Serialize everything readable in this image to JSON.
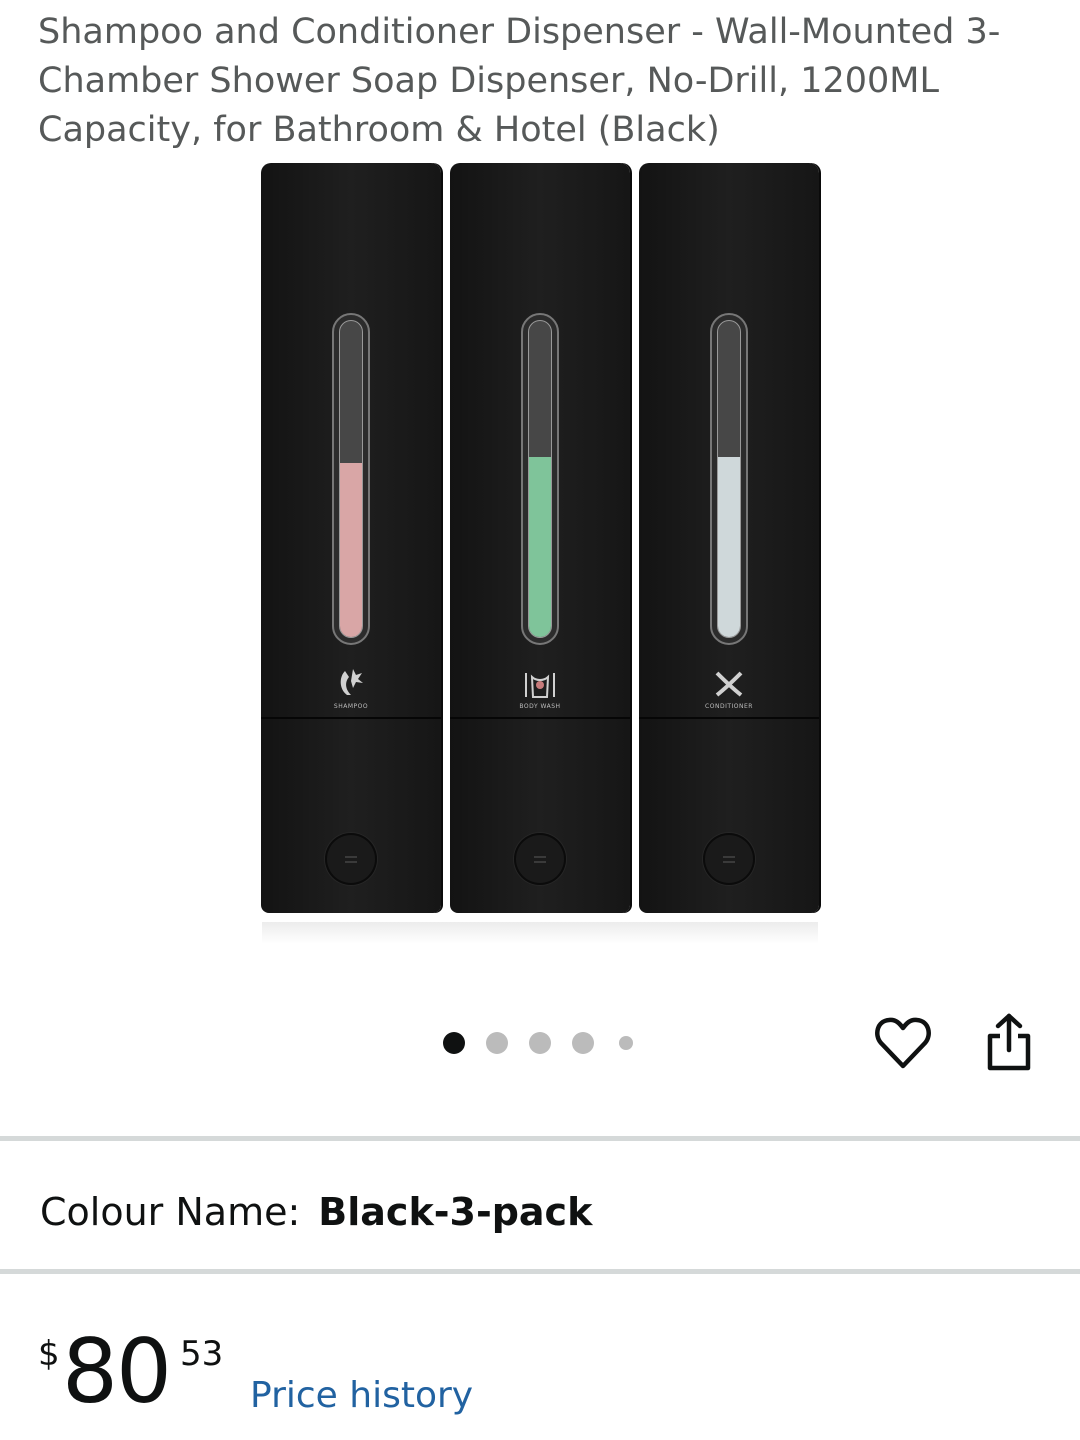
{
  "product": {
    "title": "Shampoo and Conditioner Dispenser - Wall-Mounted 3-Chamber Shower Soap Dispenser, No-Drill, 1200ML Capacity, for Bathroom & Hotel (Black)"
  },
  "gallery": {
    "chambers": [
      {
        "label": "SHAMPOO",
        "icon": "woman-leaf-icon",
        "fill_color": "#d9a6a6",
        "fill_level": 0.55
      },
      {
        "label": "BODY WASH",
        "icon": "body-icon",
        "fill_color": "#7fc49a",
        "fill_level": 0.57
      },
      {
        "label": "CONDITIONER",
        "icon": "crossed-strands-icon",
        "fill_color": "#cfd8da",
        "fill_level": 0.57
      }
    ],
    "image_count": 5,
    "active_image": 1
  },
  "actions": {
    "wishlist_icon": "heart-icon",
    "share_icon": "share-icon"
  },
  "variation": {
    "label": "Colour Name:",
    "value": "Black-3-pack"
  },
  "price": {
    "symbol": "$",
    "whole": "80",
    "fraction": "53",
    "history_link": "Price history"
  },
  "colors": {
    "link": "#2162a1",
    "divider": "#d5d9d9"
  }
}
